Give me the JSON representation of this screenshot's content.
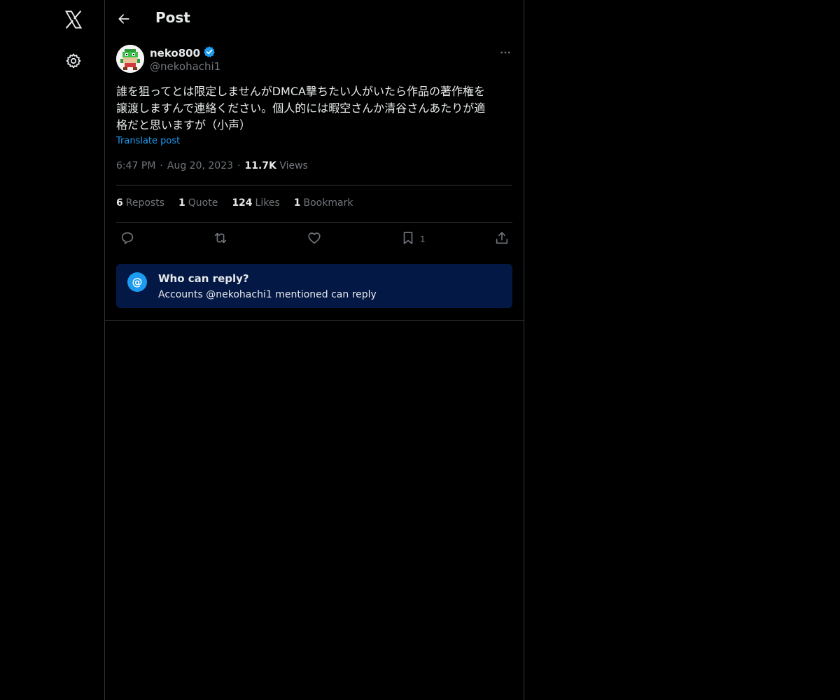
{
  "nav": {
    "logo_icon": "x-logo-icon",
    "settings_icon": "gear-icon"
  },
  "header": {
    "title": "Post",
    "back_icon": "arrow-left-icon"
  },
  "post": {
    "display_name": "neko800",
    "verified": true,
    "handle": "@nekohachi1",
    "text": "誰を狙ってとは限定しませんがDMCA撃ちたい人がいたら作品の著作権を\n譲渡しますんで連絡ください。個人的には暇空さんか清谷さんあたりが適\n格だと思いますが（小声）",
    "translate_label": "Translate post",
    "time": "6:47 PM",
    "date": "Aug 20, 2023",
    "views_count": "11.7K",
    "views_label": "Views",
    "separator": "·"
  },
  "stats": {
    "reposts": {
      "count": "6",
      "label": "Reposts"
    },
    "quotes": {
      "count": "1",
      "label": "Quote"
    },
    "likes": {
      "count": "124",
      "label": "Likes"
    },
    "bookmarks": {
      "count": "1",
      "label": "Bookmark"
    }
  },
  "actions": {
    "bookmark_count": "1"
  },
  "reply_restriction": {
    "icon": "@",
    "title": "Who can reply?",
    "subtitle": "Accounts @nekohachi1 mentioned can reply"
  },
  "colors": {
    "background": "#000000",
    "accent": "#1d9bf0",
    "border": "#2f3336",
    "muted": "#71767b",
    "notice_bg": "#031845"
  }
}
